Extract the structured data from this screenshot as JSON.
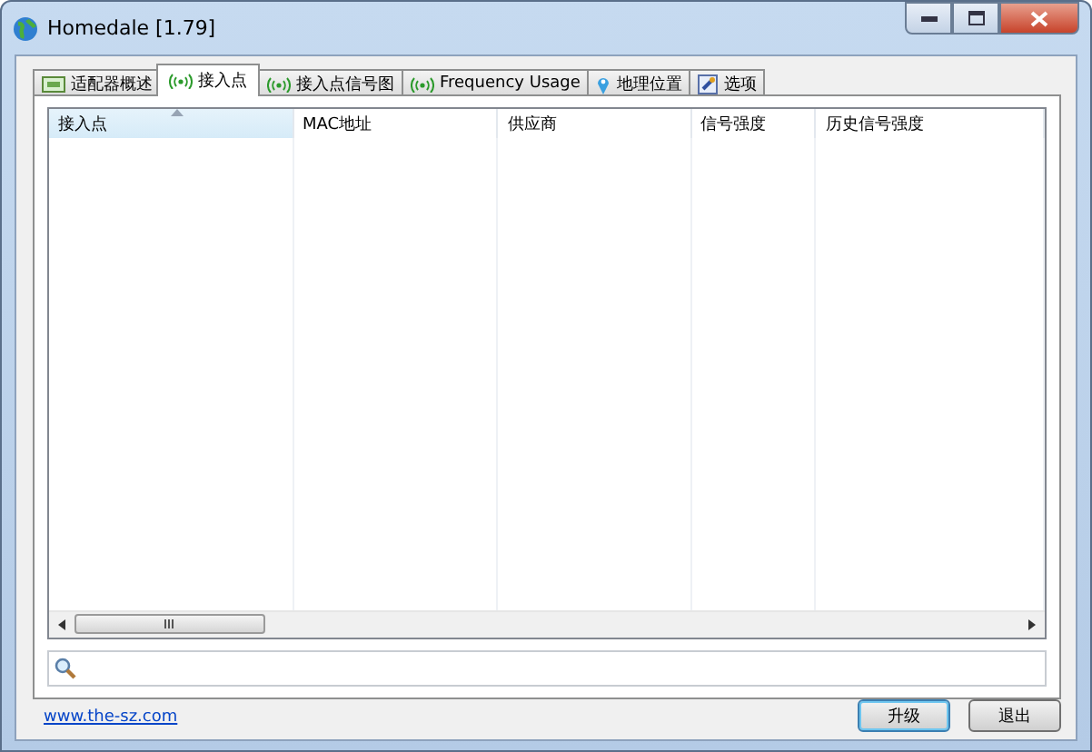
{
  "window": {
    "title": "Homedale [1.79]"
  },
  "tabs": [
    {
      "label": "适配器概述",
      "kind": "adapter",
      "selected": false
    },
    {
      "label": "接入点",
      "kind": "signal",
      "selected": true
    },
    {
      "label": "接入点信号图",
      "kind": "signal",
      "selected": false
    },
    {
      "label": "Frequency Usage",
      "kind": "signal",
      "selected": false
    },
    {
      "label": "地理位置",
      "kind": "location",
      "selected": false
    },
    {
      "label": "选项",
      "kind": "options",
      "selected": false
    }
  ],
  "table": {
    "columns": [
      {
        "label": "接入点",
        "sorted": true
      },
      {
        "label": "MAC地址",
        "sorted": false
      },
      {
        "label": "供应商",
        "sorted": false
      },
      {
        "label": "信号强度",
        "sorted": false
      },
      {
        "label": "历史信号强度",
        "sorted": false
      }
    ]
  },
  "footer": {
    "link": "www.the-sz.com",
    "buttons": [
      {
        "label": "升级",
        "kind": "default"
      },
      {
        "label": "退出",
        "kind": "normal"
      }
    ]
  }
}
